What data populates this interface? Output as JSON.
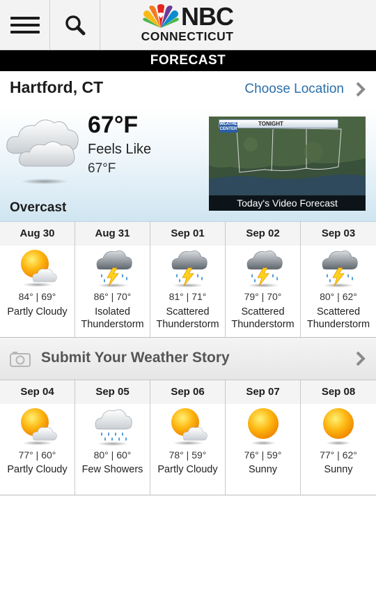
{
  "header": {
    "brand_name": "NBC",
    "brand_sub": "CONNECTICUT",
    "menu_icon": "hamburger-menu-icon",
    "search_icon": "search-icon"
  },
  "section": {
    "title": "FORECAST"
  },
  "location": {
    "city": "Hartford, CT",
    "choose_label": "Choose Location"
  },
  "current": {
    "temp": "67°F",
    "feels_label": "Feels Like",
    "feels_value": "67°F",
    "condition": "Overcast",
    "icon": "overcast-cloud-icon",
    "video_caption": "Today's Video Forecast",
    "video_banner": "TONIGHT",
    "video_logo": "WEATHER CENTER"
  },
  "forecast_row1": [
    {
      "date": "Aug 30",
      "temps": "84° | 69°",
      "cond": "Partly Cloudy",
      "icon": "partly-cloudy-icon"
    },
    {
      "date": "Aug 31",
      "temps": "86° | 70°",
      "cond": "Isolated Thunderstorm",
      "icon": "thunderstorm-icon"
    },
    {
      "date": "Sep 01",
      "temps": "81° | 71°",
      "cond": "Scattered Thunderstorm",
      "icon": "thunderstorm-icon"
    },
    {
      "date": "Sep 02",
      "temps": "79° | 70°",
      "cond": "Scattered Thunderstorm",
      "icon": "thunderstorm-icon"
    },
    {
      "date": "Sep 03",
      "temps": "80° | 62°",
      "cond": "Scattered Thunderstorm",
      "icon": "thunderstorm-icon"
    }
  ],
  "submit": {
    "label": "Submit Your Weather Story",
    "icon": "camera-icon"
  },
  "forecast_row2": [
    {
      "date": "Sep 04",
      "temps": "77° | 60°",
      "cond": "Partly Cloudy",
      "icon": "partly-cloudy-icon"
    },
    {
      "date": "Sep 05",
      "temps": "80° | 60°",
      "cond": "Few Showers",
      "icon": "showers-icon"
    },
    {
      "date": "Sep 06",
      "temps": "78° | 59°",
      "cond": "Partly Cloudy",
      "icon": "partly-cloudy-icon"
    },
    {
      "date": "Sep 07",
      "temps": "76° | 59°",
      "cond": "Sunny",
      "icon": "sunny-icon"
    },
    {
      "date": "Sep 08",
      "temps": "77° | 62°",
      "cond": "Sunny",
      "icon": "sunny-icon"
    }
  ],
  "colors": {
    "link_blue": "#2a6fa8",
    "section_bar": "#000000",
    "sun_orange": "#f7a41d"
  }
}
